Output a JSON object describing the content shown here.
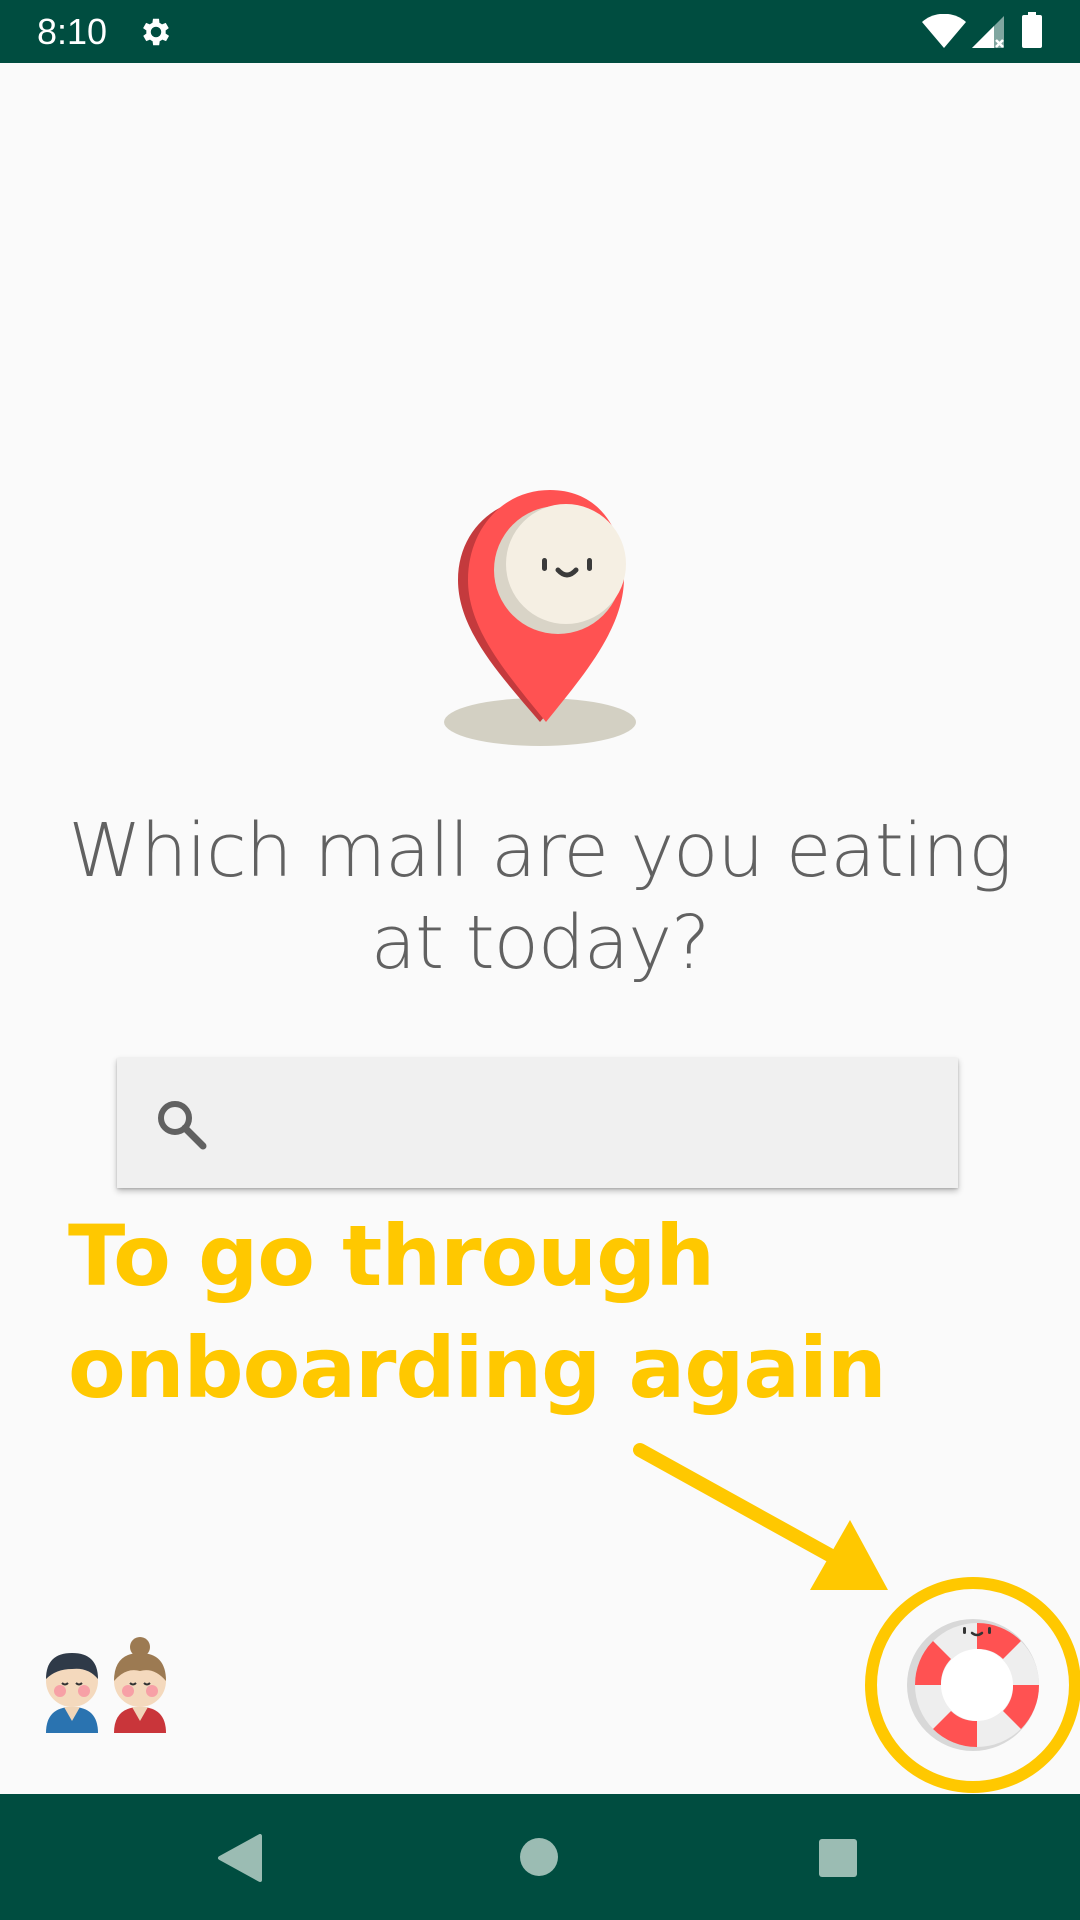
{
  "status_bar": {
    "time": "8:10",
    "icons": [
      "gear-icon",
      "wifi-icon",
      "cell-signal-icon",
      "battery-icon"
    ],
    "background": "#004d40"
  },
  "main": {
    "illustration": "location-pin-icon",
    "question": "Which mall are you eating at today?",
    "search": {
      "icon": "search-icon",
      "value": "",
      "placeholder": ""
    }
  },
  "annotation": {
    "text_line1": "To go through",
    "text_line2": "onboarding again",
    "color": "#ffc800"
  },
  "help_button": {
    "icon": "lifebuoy-icon"
  },
  "avatars": {
    "icon": "couple-avatars-icon"
  },
  "nav_bar": {
    "buttons": [
      "back-icon",
      "home-icon",
      "recents-icon"
    ],
    "background": "#004d40"
  },
  "colors": {
    "accent_red": "#ff5252",
    "annotation_yellow": "#ffc800",
    "bar_green": "#004d40"
  }
}
